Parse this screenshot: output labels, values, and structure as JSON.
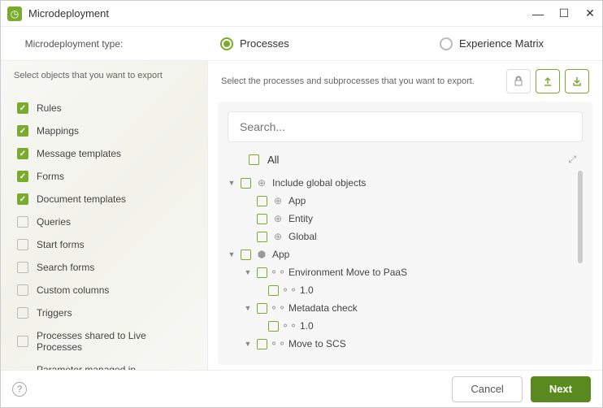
{
  "window": {
    "title": "Microdeployment"
  },
  "type_row": {
    "label": "Microdeployment type:",
    "options": {
      "processes": "Processes",
      "experience": "Experience Matrix"
    },
    "selected": "processes"
  },
  "left": {
    "header": "Select objects that you want to export",
    "items": [
      {
        "label": "Rules",
        "checked": true
      },
      {
        "label": "Mappings",
        "checked": true
      },
      {
        "label": "Message templates",
        "checked": true
      },
      {
        "label": "Forms",
        "checked": true
      },
      {
        "label": "Document templates",
        "checked": true
      },
      {
        "label": "Queries",
        "checked": false
      },
      {
        "label": "Start forms",
        "checked": false
      },
      {
        "label": "Search forms",
        "checked": false
      },
      {
        "label": "Custom columns",
        "checked": false
      },
      {
        "label": "Triggers",
        "checked": false
      },
      {
        "label": "Processes shared to Live Processes",
        "checked": false
      },
      {
        "label": "Parameter managed in development",
        "checked": false
      }
    ]
  },
  "right": {
    "header": "Select the processes and subprocesses that you want to export.",
    "search_placeholder": "Search...",
    "all_label": "All",
    "tree": {
      "include_global": "Include global objects",
      "app": "App",
      "entity": "Entity",
      "global": "Global",
      "app_node": "App",
      "p1": "Environment Move to PaaS",
      "p2": "Metadata check",
      "p3": "Move to SCS",
      "version": "1.0"
    }
  },
  "footer": {
    "cancel": "Cancel",
    "next": "Next"
  }
}
